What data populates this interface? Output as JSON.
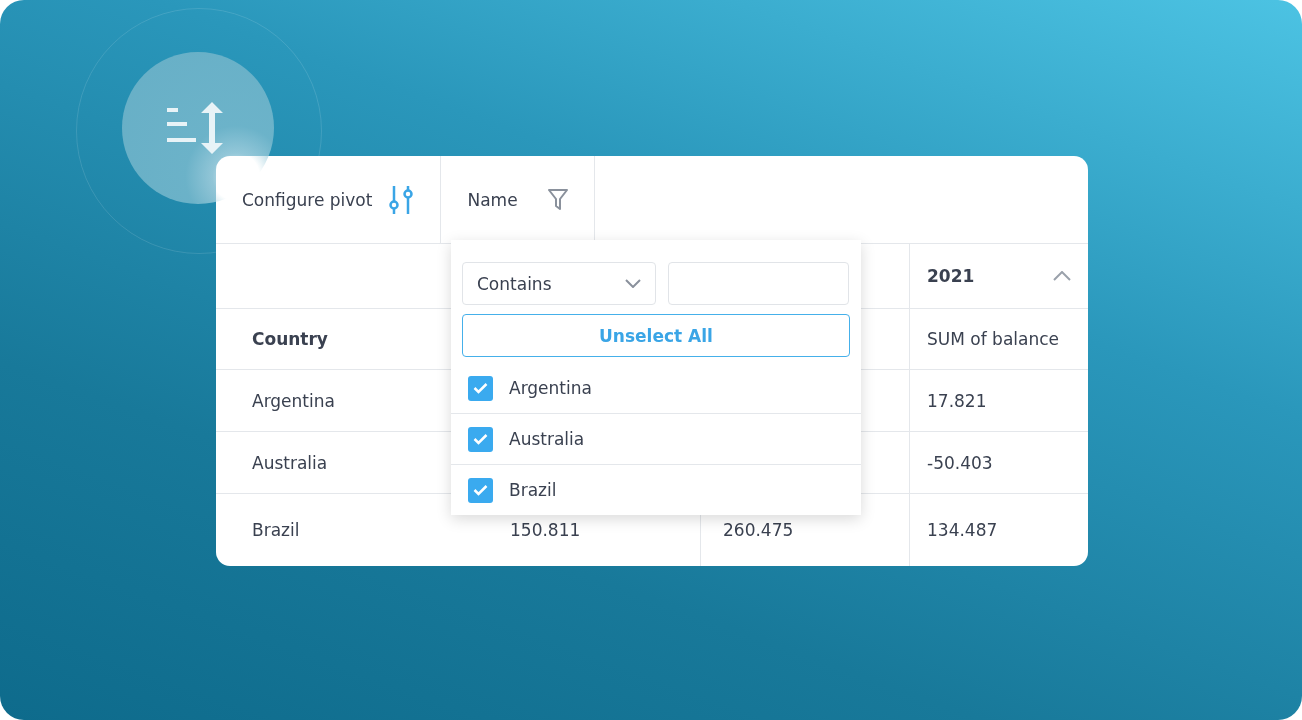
{
  "toolbar": {
    "configure_label": "Configure pivot",
    "filter_field": {
      "label": "Name",
      "active": false
    }
  },
  "table": {
    "header_top": {
      "column_4": "2021",
      "expanded": true
    },
    "header": {
      "country": "Country",
      "column_4": "SUM of balance"
    },
    "rows": [
      {
        "country": "Argentina",
        "column_4": "17.821"
      },
      {
        "country": "Australia",
        "column_4": "-50.403"
      },
      {
        "country": "Brazil",
        "column_2": "150.811",
        "column_3": "260.475",
        "column_4": "134.487"
      }
    ]
  },
  "filter_popup": {
    "condition": "Contains",
    "unselect_label": "Unselect All",
    "items": [
      {
        "label": "Argentina",
        "checked": true
      },
      {
        "label": "Australia",
        "checked": true
      },
      {
        "label": "Brazil",
        "checked": true
      }
    ]
  }
}
